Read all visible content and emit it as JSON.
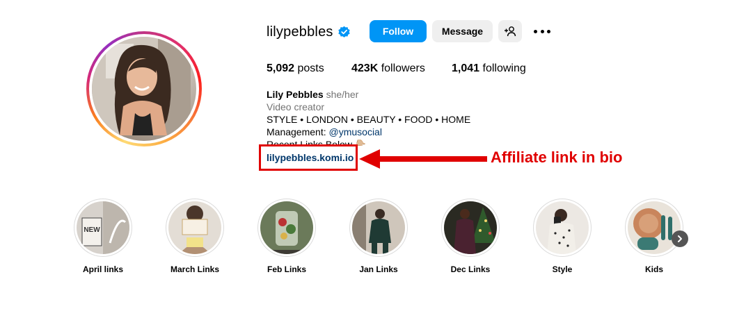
{
  "profile": {
    "username": "lilypebbles",
    "verified_icon": "verified-badge-icon",
    "follow_label": "Follow",
    "message_label": "Message",
    "add_user_icon": "add-person-icon",
    "more_icon": "more-options-icon",
    "stats": {
      "posts_count": "5,092",
      "posts_label": "posts",
      "followers_count": "423K",
      "followers_label": "followers",
      "following_count": "1,041",
      "following_label": "following"
    },
    "bio": {
      "name": "Lily Pebbles",
      "pronouns": "she/her",
      "category": "Video creator",
      "line1": "STYLE • LONDON • BEAUTY • FOOD • HOME",
      "management_prefix": "Management: ",
      "management_handle": "@ymusocial",
      "line3": "Recent Links Below 👇🏼",
      "link": "lilypebbles.komi.io"
    }
  },
  "annotation": {
    "text": "Affiliate link in bio",
    "color": "#e00000"
  },
  "highlights": [
    {
      "label": "April links"
    },
    {
      "label": "March Links"
    },
    {
      "label": "Feb Links"
    },
    {
      "label": "Jan Links"
    },
    {
      "label": "Dec Links"
    },
    {
      "label": "Style"
    },
    {
      "label": "Kids"
    }
  ],
  "colors": {
    "follow_blue": "#0095f6",
    "secondary_button": "#efefef",
    "link_blue": "#00376b"
  }
}
